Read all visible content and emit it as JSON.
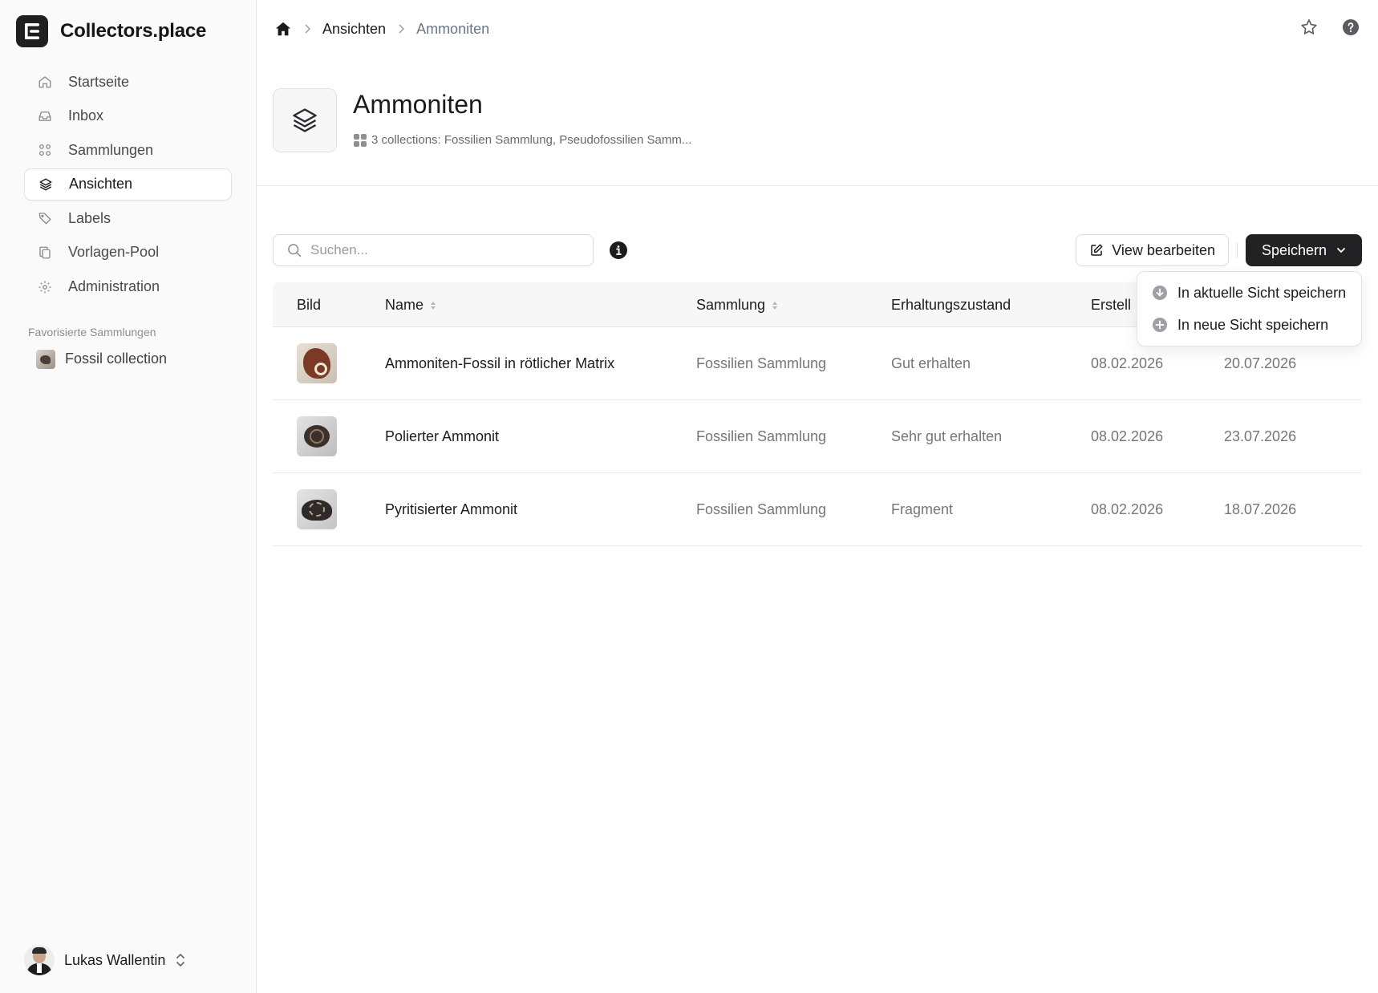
{
  "brand": {
    "name": "Collectors.place"
  },
  "sidebar": {
    "nav": [
      {
        "label": "Startseite",
        "icon": "home-icon"
      },
      {
        "label": "Inbox",
        "icon": "inbox-icon"
      },
      {
        "label": "Sammlungen",
        "icon": "grid-icon"
      },
      {
        "label": "Ansichten",
        "icon": "layers-icon",
        "active": true
      },
      {
        "label": "Labels",
        "icon": "tag-icon"
      },
      {
        "label": "Vorlagen-Pool",
        "icon": "copy-icon"
      },
      {
        "label": "Administration",
        "icon": "gear-icon"
      }
    ],
    "favorites_heading": "Favorisierte Sammlungen",
    "favorites": [
      {
        "label": "Fossil collection"
      }
    ],
    "user": {
      "name": "Lukas Wallentin"
    }
  },
  "breadcrumb": {
    "items": [
      "Ansichten",
      "Ammoniten"
    ]
  },
  "header": {
    "title": "Ammoniten",
    "subtitle": "3 collections: Fossilien Sammlung, Pseudofossilien Samm..."
  },
  "toolbar": {
    "search_placeholder": "Suchen...",
    "edit_label": "View bearbeiten",
    "save_label": "Speichern"
  },
  "save_menu": {
    "items": [
      {
        "label": "In aktuelle Sicht speichern",
        "icon": "arrow-down-circle-icon"
      },
      {
        "label": "In neue Sicht speichern",
        "icon": "plus-circle-icon"
      }
    ]
  },
  "table": {
    "columns": [
      "Bild",
      "Name",
      "Sammlung",
      "Erhaltungszustand",
      "Erstell"
    ],
    "rows": [
      {
        "name": "Ammoniten-Fossil in rötlicher Matrix",
        "collection": "Fossilien Sammlung",
        "condition": "Gut erhalten",
        "created": "08.02.2026",
        "updated": "20.07.2026"
      },
      {
        "name": "Polierter Ammonit",
        "collection": "Fossilien Sammlung",
        "condition": "Sehr gut erhalten",
        "created": "08.02.2026",
        "updated": "23.07.2026"
      },
      {
        "name": "Pyritisierter Ammonit",
        "collection": "Fossilien Sammlung",
        "condition": "Fragment",
        "created": "08.02.2026",
        "updated": "18.07.2026"
      }
    ]
  },
  "colors": {
    "primary_button": "#222224",
    "sidebar_bg": "#fafafa",
    "muted_text": "#76767a"
  }
}
